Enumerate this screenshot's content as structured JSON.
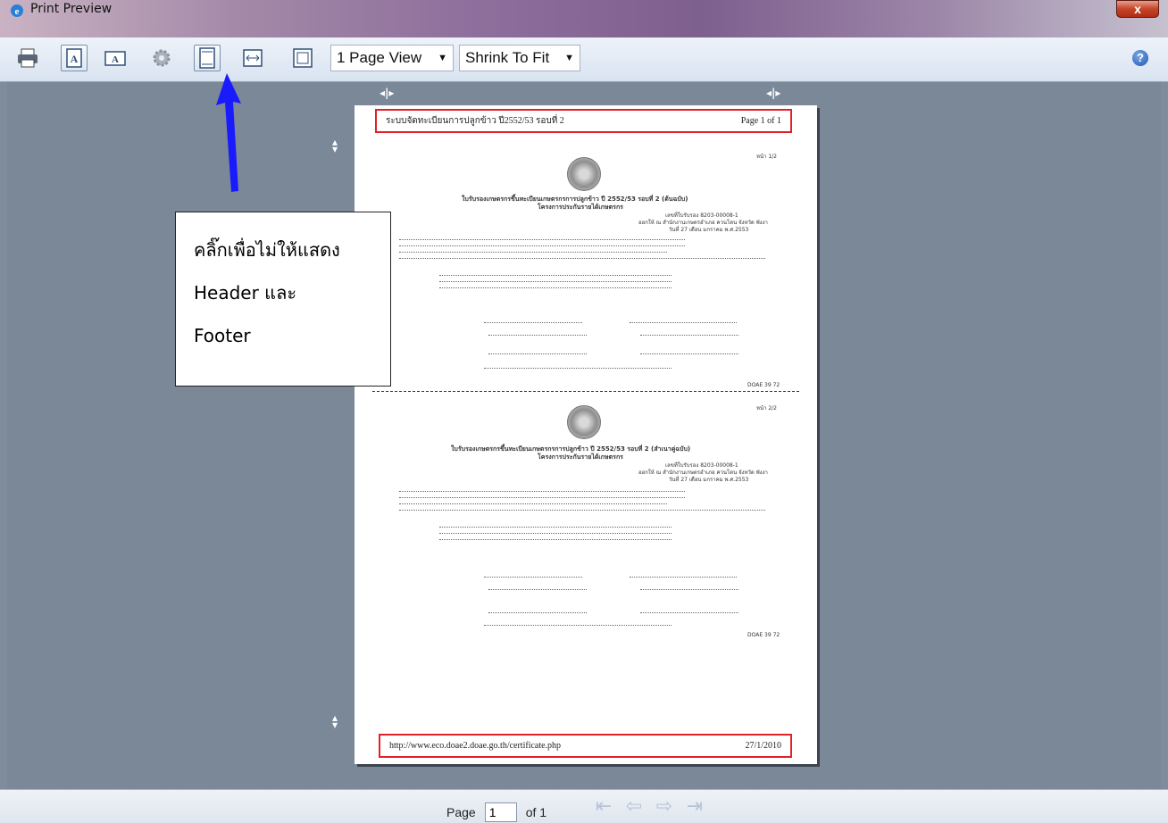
{
  "window": {
    "title": "Print Preview",
    "close_label": "x"
  },
  "toolbar": {
    "page_view": "1 Page View",
    "zoom": "Shrink To Fit",
    "help": "?"
  },
  "page": {
    "header_left": "ระบบจัดทะเบียนการปลูกข้าว ปี2552/53 รอบที่ 2",
    "header_right": "Page 1 of 1",
    "footer_left": "http://www.eco.doae2.doae.go.th/certificate.php",
    "footer_right": "27/1/2010",
    "copy1": {
      "ref": "หน้า 1/2",
      "title": "ใบรับรองเกษตรกรขึ้นทะเบียนเกษตรกรการปลูกข้าว ปี 2552/53 รอบที่ 2 (ต้นฉบับ)",
      "subtitle": "โครงการประกันรายได้เกษตรกร",
      "cert_no": "เลขที่ใบรับรอง 8203-00008-1",
      "office": "ออกให้ ณ สำนักงานเกษตรอำเภอ ควนโดน จังหวัด พังงา",
      "date": "วันที่ 27 เดือน มกราคม พ.ศ.2553",
      "code": "DOAE 39 72"
    },
    "copy2": {
      "ref": "หน้า 2/2",
      "title": "ใบรับรองเกษตรกรขึ้นทะเบียนเกษตรกรการปลูกข้าว ปี 2552/53 รอบที่ 2 (สำเนาคู่ฉบับ)",
      "subtitle": "โครงการประกันรายได้เกษตรกร",
      "cert_no": "เลขที่ใบรับรอง 8203-00008-1",
      "office": "ออกให้ ณ สำนักงานเกษตรอำเภอ ควนโดน จังหวัด พังงา",
      "date": "วันที่ 27 เดือน มกราคม พ.ศ.2553",
      "code": "DOAE 39 72"
    }
  },
  "callout": {
    "line1": "คลิ๊กเพื่อไม่ให้แสดง",
    "line2": "Header และ",
    "line3": "Footer"
  },
  "status": {
    "page_label": "Page",
    "page_value": "1",
    "of_label": "of 1"
  },
  "colors": {
    "highlight": "#e2202a",
    "arrow": "#1a1aff"
  }
}
